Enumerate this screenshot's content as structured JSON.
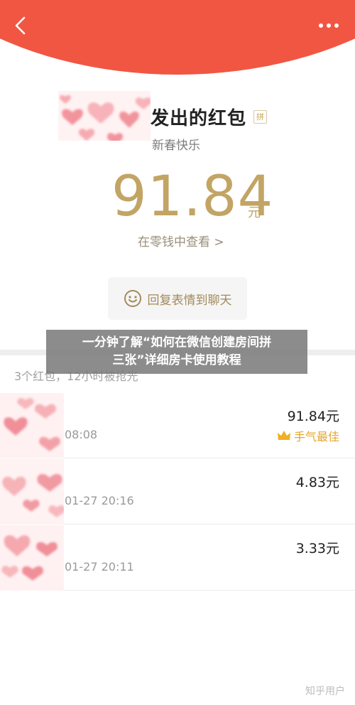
{
  "header": {
    "back_icon": "chevron-left-icon",
    "more_icon": "more-dots-icon",
    "color": "#f15643"
  },
  "packet": {
    "title": "发出的红包",
    "badge": "拼",
    "greeting": "新春快乐",
    "amount": "91.84",
    "unit": "元",
    "change_link": "在零钱中查看 >",
    "reply_label": "回复表情到聊天",
    "accent": "#c2a464"
  },
  "summary": "3个红包，12小时被抢光",
  "records": [
    {
      "time": "08:08",
      "amount": "91.84元",
      "best": "手气最佳"
    },
    {
      "time": "01-27 20:16",
      "amount": "4.83元"
    },
    {
      "time": "01-27 20:11",
      "amount": "3.33元"
    }
  ],
  "overlay": {
    "line1": "一分钟了解“如何在微信创建房间拼",
    "line2": "三张”详细房卡使用教程"
  },
  "watermark": "知乎用户"
}
